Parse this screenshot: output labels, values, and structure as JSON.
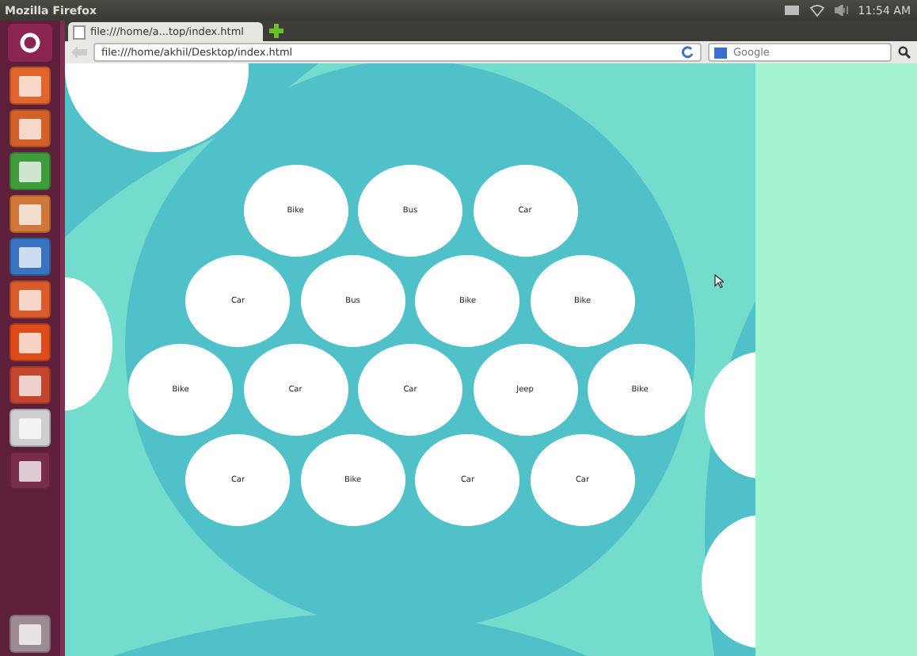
{
  "panel": {
    "title": "Mozilla Firefox",
    "clock": "11:54 AM"
  },
  "tab": {
    "label": "file:///home/a...top/index.html"
  },
  "nav": {
    "url": "file:///home/akhil/Desktop/index.html",
    "search_placeholder": "Google"
  },
  "bubble_rows": [
    [
      "Bike",
      "Bus",
      "Car"
    ],
    [
      "Car",
      "Bus",
      "Bike",
      "Bike"
    ],
    [
      "Bike",
      "Car",
      "Car",
      "Jeep",
      "Bike"
    ],
    [
      "Car",
      "Bike",
      "Car",
      "Car"
    ]
  ]
}
